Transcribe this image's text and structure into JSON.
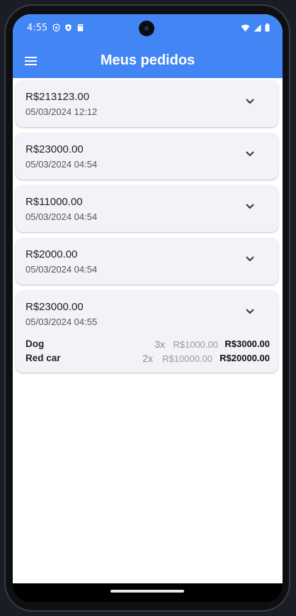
{
  "status_bar": {
    "time": "4:55",
    "left_icons": [
      "shield-icon",
      "vpn-shield-icon",
      "sd-card-icon"
    ],
    "right_icons": [
      "wifi-icon",
      "cell-signal-icon",
      "battery-icon"
    ]
  },
  "app_bar": {
    "title": "Meus pedidos",
    "menu_icon": "hamburger-menu-icon",
    "color": "#4285f4"
  },
  "orders": [
    {
      "amount": "R$213123.00",
      "date": "05/03/2024 12:12",
      "expanded": false
    },
    {
      "amount": "R$23000.00",
      "date": "05/03/2024 04:54",
      "expanded": false
    },
    {
      "amount": "R$11000.00",
      "date": "05/03/2024 04:54",
      "expanded": false
    },
    {
      "amount": "R$2000.00",
      "date": "05/03/2024 04:54",
      "expanded": false
    },
    {
      "amount": "R$23000.00",
      "date": "05/03/2024 04:55",
      "expanded": true,
      "items": [
        {
          "name": "Dog",
          "qty": "3x",
          "unit_price": "R$1000.00",
          "total": "R$3000.00"
        },
        {
          "name": "Red car",
          "qty": "2x",
          "unit_price": "R$10000.00",
          "total": "R$20000.00"
        }
      ]
    }
  ]
}
